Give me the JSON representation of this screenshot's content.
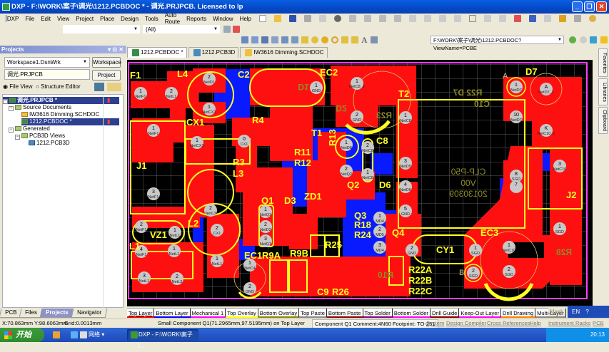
{
  "window": {
    "title": "DXP - F:\\WORK\\案子\\调光\\1212.PCBDOC * - 调光.PRJPCB. Licensed to lp",
    "minimize": "_",
    "restore": "❐",
    "close": "✕"
  },
  "menu": [
    "DXP",
    "File",
    "Edit",
    "View",
    "Project",
    "Place",
    "Design",
    "Tools",
    "Auto Route",
    "Reports",
    "Window",
    "Help"
  ],
  "filter": {
    "combo1": "",
    "combo2": "",
    "combo3": "(All)"
  },
  "address": "F:\\WORK\\案子\\调光\\1212.PCBDOC?ViewName=PCBE",
  "projects_panel": {
    "title": "Projects",
    "workspace_combo": "Workspace1.DsnWrk",
    "workspace_button": "Workspace",
    "project_field": "调光.PRJPCB",
    "project_button": "Project",
    "view_file": "File View",
    "view_structure": "Structure Editor",
    "tree": [
      {
        "label": "调光.PRJPCB *"
      },
      {
        "label": "Source Documents"
      },
      {
        "label": "IW3616 Dimming.SCHDOC"
      },
      {
        "label": "1212.PCBDOC *"
      },
      {
        "label": "Generated"
      },
      {
        "label": "PCB3D Views"
      },
      {
        "label": "1212.PCB3D"
      }
    ],
    "tabs": [
      "PCB",
      "Files",
      "Projects",
      "Navigator"
    ]
  },
  "doc_tabs": [
    "1212.PCBDOC *",
    "1212.PCB3D",
    "IW3616 Dimming.SCHDOC"
  ],
  "right_tabs": [
    "Favorites",
    "Libraries",
    "Clipboard"
  ],
  "layer_tabs": [
    "Top Layer",
    "Bottom Layer",
    "Mechanical 1",
    "Top Overlay",
    "Bottom Overlay",
    "Top Paste",
    "Bottom Paste",
    "Top Solder",
    "Bottom Solder",
    "Drill Guide",
    "Keep-Out Layer",
    "Drill Drawing",
    "Multi-Layer"
  ],
  "mask_label": "Mask",
  "lang": "EN",
  "status": {
    "coords": "X:70.863mm Y:98.6063mm",
    "grid": "Grid:0.0013mm",
    "component": "Small Component Q1(71.2965mm,97.5195mm) on Top Layer",
    "comment": "Component Q1 Comment:4N60 Footprint: TO-251",
    "buttons": [
      "System",
      "Design Compiler",
      "Cross References",
      "Help",
      "Instrument Racks",
      "PCB"
    ]
  },
  "taskbar": {
    "start": "开始",
    "network": "网络",
    "task": "DXP - F:\\WORK\\案子\\...",
    "clock": "20:13"
  },
  "pcb": {
    "labels": [
      "F1",
      "L4",
      "C2",
      "EC2",
      "T2",
      "D7",
      "CX1",
      "R4",
      "T1",
      "R13",
      "C8",
      "R11",
      "R12",
      "J1",
      "R3",
      "L3",
      "Q1",
      "D3",
      "ZD1",
      "Q2",
      "D6",
      "J2",
      "L2",
      "VZ1",
      "L1",
      "Q3",
      "R18",
      "R24",
      "Q4",
      "R25",
      "EC1",
      "R9A",
      "R9B",
      "CY1",
      "EC3",
      "R22A",
      "R22B",
      "R22C",
      "C9",
      "R26",
      "A",
      "B"
    ],
    "bottom_labels": [
      "R22 D7",
      "C10",
      "CLP-P50",
      "V00",
      "20130309",
      "D1",
      "D2",
      "R23",
      "R28",
      "R10"
    ],
    "pads": [
      {
        "num": "1",
        "net": "NetF1"
      },
      {
        "num": "2",
        "net": "NetL1"
      },
      {
        "num": "1",
        "net": "NetF1"
      },
      {
        "num": "3",
        "net": "NetF1"
      },
      {
        "num": "2",
        "net": "NetD1"
      },
      {
        "num": "1",
        "net": "NetCX1"
      },
      {
        "num": "1",
        "net": "NetCX1"
      },
      {
        "num": "0",
        "net": "CX1"
      },
      {
        "num": "2",
        "net": "NetL3"
      },
      {
        "num": "2",
        "net": "CX1"
      },
      {
        "num": "1",
        "net": "NetL1"
      },
      {
        "num": "2",
        "net": "NetF1"
      },
      {
        "num": "1",
        "net": "NetL1"
      },
      {
        "num": "4",
        "net": "NetF1"
      },
      {
        "num": "1",
        "net": "NetL1"
      },
      {
        "num": "3",
        "net": "NetL1"
      },
      {
        "num": "2",
        "net": "NetL3"
      },
      {
        "num": "1",
        "net": "NetQ1"
      },
      {
        "num": "2",
        "net": "NetD2"
      },
      {
        "num": "3",
        "net": "NetQ1"
      },
      {
        "num": "1",
        "net": "NetC4"
      },
      {
        "num": "2",
        "net": "GND"
      },
      {
        "num": "1",
        "net": "GND"
      },
      {
        "num": "1",
        "net": "NetC8_2"
      },
      {
        "num": "2",
        "net": "GND"
      },
      {
        "num": "1",
        "net": "NetC8"
      },
      {
        "num": "3",
        "net": "NetD5"
      },
      {
        "num": "4",
        "net": "NetD6"
      },
      {
        "num": "5",
        "net": "GND"
      },
      {
        "num": "8",
        "net": "SGD"
      },
      {
        "num": "7",
        "net": ""
      },
      {
        "num": "1",
        "net": "NetD7"
      },
      {
        "num": "A",
        "net": "NetD7_1"
      },
      {
        "num": "10",
        "net": "NetD7"
      },
      {
        "num": "K",
        "net": "NetC10_1"
      },
      {
        "num": "3",
        "net": "NetC10"
      },
      {
        "num": "1",
        "net": "SGD"
      },
      {
        "num": "2",
        "net": "GND"
      },
      {
        "num": "1",
        "net": "SGD"
      },
      {
        "num": "2",
        "net": "SGD"
      },
      {
        "num": "1",
        "net": "NetC10"
      },
      {
        "num": "2",
        "net": "SGD"
      },
      {
        "num": "2",
        "net": "NetC8"
      },
      {
        "num": "1",
        "net": "NetC8"
      },
      {
        "num": "1",
        "net": "NetD8"
      },
      {
        "num": "2",
        "net": "NetQ2"
      },
      {
        "num": "1",
        "net": "MD4"
      },
      {
        "num": "2",
        "net": "MD5"
      },
      {
        "num": "3",
        "net": "MD4"
      }
    ]
  },
  "colors": {
    "top_layer": "#ff0000",
    "bottom_layer": "#0000ff",
    "top_overlay": "#ffff00",
    "bottom_overlay": "#808020",
    "board": "#000000",
    "pad": "#c8c8c8",
    "keepout": "#ff00ff"
  }
}
